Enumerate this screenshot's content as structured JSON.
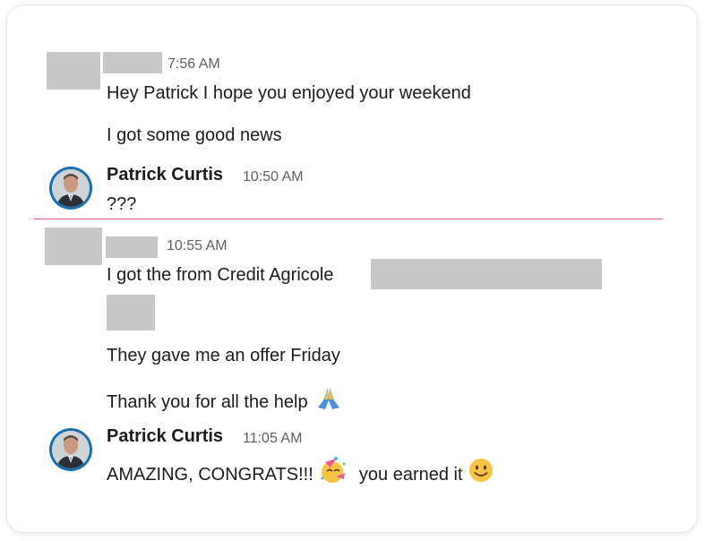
{
  "messages": [
    {
      "sender": "",
      "time": "7:56 AM",
      "lines": [
        "Hey Patrick I hope you enjoyed your weekend",
        "I got some good news"
      ]
    },
    {
      "sender": "Patrick Curtis",
      "time": "10:50 AM",
      "lines": [
        "???"
      ]
    },
    {
      "sender": "",
      "time": "10:55 AM",
      "lines": [
        "I got the from Credit Agricole",
        "They gave me an offer Friday",
        "Thank you for all the help"
      ]
    },
    {
      "sender": "Patrick Curtis",
      "time": "11:05 AM",
      "line_part1": "AMAZING, CONGRATS!!!",
      "line_part2": "you earned it"
    }
  ],
  "icons": {
    "pray": "pray-emoji-icon",
    "party": "partying-face-emoji-icon",
    "smile": "slightly-smiling-face-emoji-icon"
  },
  "colors": {
    "new_message_divider": "#e8578f",
    "avatar_ring": "#1a6fae",
    "redaction": "#c8c8c8"
  }
}
